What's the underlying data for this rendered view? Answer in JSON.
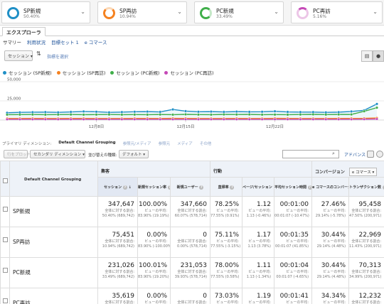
{
  "segments": [
    {
      "name": "SP新規",
      "pct": "50.40%",
      "color": "#1f8fc6"
    },
    {
      "name": "SP再訪",
      "pct": "10.94%",
      "color": "#f58220"
    },
    {
      "name": "PC新規",
      "pct": "33.49%",
      "color": "#3fae49"
    },
    {
      "name": "PC再訪",
      "pct": "5.16%",
      "color": "#c549b7"
    }
  ],
  "tabs": {
    "explorer": "エクスプローラ"
  },
  "subnav": {
    "summary": "サマリー",
    "site_usage": "利用状況",
    "goal_set": "目標セット 1",
    "ecommerce": "e コマース"
  },
  "chart_controls": {
    "metric": "セッション",
    "add_metric": "指標を選択"
  },
  "chart_data": {
    "type": "line",
    "x": [
      "12/01",
      "12/02",
      "12/03",
      "12/04",
      "12/05",
      "12/06",
      "12/07",
      "12/08",
      "12/09",
      "12/10",
      "12/11",
      "12/12",
      "12/13",
      "12/14",
      "12/15",
      "12/16",
      "12/17",
      "12/18",
      "12/19",
      "12/20",
      "12/21",
      "12/22",
      "12/23",
      "12/24",
      "12/25",
      "12/26",
      "12/27",
      "12/28",
      "12/29",
      "12/30"
    ],
    "x_tick_labels": [
      "12月8日",
      "12月15日",
      "12月22日"
    ],
    "y_tick_labels": [
      "50,000",
      "25,000"
    ],
    "ylim": [
      0,
      50000
    ],
    "grid": true,
    "series": [
      {
        "name": "セッション (SP新規)",
        "color": "#1f8fc6",
        "values": [
          9500,
          10000,
          10200,
          10400,
          10000,
          10600,
          11200,
          10800,
          10000,
          10400,
          10800,
          11000,
          10600,
          13800,
          11600,
          10800,
          11000,
          10600,
          11000,
          10700,
          10800,
          11400,
          10600,
          10400,
          10400,
          10000,
          10300,
          11200,
          12700,
          21000
        ]
      },
      {
        "name": "セッション (SP再訪)",
        "color": "#f58220",
        "values": [
          2000,
          2000,
          2100,
          2000,
          2000,
          2100,
          2100,
          2000,
          2000,
          2000,
          2100,
          2100,
          2000,
          2200,
          2100,
          2000,
          2000,
          2000,
          2100,
          2000,
          2000,
          2200,
          2100,
          2000,
          2000,
          2000,
          2100,
          2100,
          2200,
          2700
        ]
      },
      {
        "name": "セッション (PC新規)",
        "color": "#3fae49",
        "values": [
          7000,
          7100,
          7200,
          7000,
          7100,
          7200,
          7000,
          7100,
          7200,
          7000,
          7100,
          7000,
          7200,
          7000,
          7400,
          7100,
          7000,
          7300,
          7200,
          7300,
          7000,
          7100,
          7000,
          7200,
          7400,
          7100,
          7300,
          7300,
          11400,
          16100
        ]
      },
      {
        "name": "セッション (PC再訪)",
        "color": "#c549b7",
        "values": [
          1000,
          1000,
          1000,
          1000,
          1000,
          1000,
          1000,
          1000,
          1000,
          1000,
          1000,
          1000,
          1000,
          1000,
          1000,
          1000,
          1000,
          1000,
          1000,
          1000,
          1000,
          1000,
          1000,
          1000,
          1000,
          1000,
          1000,
          1000,
          1100,
          1400
        ]
      }
    ]
  },
  "dimensions": {
    "label": "プライマリ ディメンション:",
    "active": "Default Channel Grouping",
    "others": [
      "参照元/メディア",
      "参照元",
      "メディア",
      "その他"
    ]
  },
  "toolbar": {
    "secondary_dim": "セカンダリ ディメンション",
    "sort_label": "並び替えの種類:",
    "sort_value": "デフォルト",
    "advanced": "アドバンス",
    "plot_rows": "行をプロット"
  },
  "table": {
    "dim_header": "Default Channel Grouping",
    "groups": {
      "acquisition": "集客",
      "behavior": "行動",
      "conversion": "コンバージョン",
      "conversion_select": "e コマース"
    },
    "columns": [
      "セッション",
      "新規セッション率",
      "新規ユーザー",
      "直帰率",
      "ページ/セッション",
      "平均セッション時間",
      "e コマースのコンバージョン率",
      "トランザクション数"
    ],
    "rows": [
      {
        "label": "SP新規",
        "cells": [
          {
            "v": "347,647",
            "s1": "全体に対する割合:",
            "s2": "50.40% (689,742)"
          },
          {
            "v": "100.00%",
            "s1": "ビューの平均:",
            "s2": "83.90% (19.19%)"
          },
          {
            "v": "347,660",
            "s1": "全体に対する割合:",
            "s2": "60.07% (578,714)"
          },
          {
            "v": "78.25%",
            "s1": "ビューの平均:",
            "s2": "77.55% (0.91%)"
          },
          {
            "v": "1.12",
            "s1": "ビューの平均:",
            "s2": "1.13 (-0.46%)"
          },
          {
            "v": "00:01:00",
            "s1": "ビューの平均:",
            "s2": "00:01:07 (-10.47%)"
          },
          {
            "v": "27.46%",
            "s1": "ビューの平均:",
            "s2": "29.14% (-5.78%)"
          },
          {
            "v": "95,458",
            "s1": "全体に対する割合:",
            "s2": "47.50% (200,971)"
          }
        ]
      },
      {
        "label": "SP再訪",
        "cells": [
          {
            "v": "75,451",
            "s1": "全体に対する割合:",
            "s2": "10.94% (689,742)"
          },
          {
            "v": "0.00%",
            "s1": "ビューの平均:",
            "s2": "83.90% (-100.00%)"
          },
          {
            "v": "0",
            "s1": "全体に対する割合:",
            "s2": "0.00% (578,714)"
          },
          {
            "v": "75.11%",
            "s1": "ビューの平均:",
            "s2": "77.55% (-3.15%)"
          },
          {
            "v": "1.17",
            "s1": "ビューの平均:",
            "s2": "1.13 (3.78%)"
          },
          {
            "v": "00:01:35",
            "s1": "ビューの平均:",
            "s2": "00:01:07 (41.85%)"
          },
          {
            "v": "30.44%",
            "s1": "ビューの平均:",
            "s2": "29.14% (4.48%)"
          },
          {
            "v": "22,969",
            "s1": "全体に対する割合:",
            "s2": "11.43% (200,971)"
          }
        ]
      },
      {
        "label": "PC新規",
        "cells": [
          {
            "v": "231,026",
            "s1": "全体に対する割合:",
            "s2": "33.49% (689,742)"
          },
          {
            "v": "100.01%",
            "s1": "ビューの平均:",
            "s2": "83.90% (19.20%)"
          },
          {
            "v": "231,053",
            "s1": "全体に対する割合:",
            "s2": "39.93% (578,714)"
          },
          {
            "v": "78.00%",
            "s1": "ビューの平均:",
            "s2": "77.55% (0.58%)"
          },
          {
            "v": "1.11",
            "s1": "ビューの平均:",
            "s2": "1.13 (-1.34%)"
          },
          {
            "v": "00:01:04",
            "s1": "ビューの平均:",
            "s2": "00:01:07 (-4.65%)"
          },
          {
            "v": "30.44%",
            "s1": "ビューの平均:",
            "s2": "29.14% (4.48%)"
          },
          {
            "v": "70,313",
            "s1": "全体に対する割合:",
            "s2": "34.99% (200,971)"
          }
        ]
      },
      {
        "label": "PC再訪",
        "cells": [
          {
            "v": "35,619",
            "s1": "全体に対する割合:",
            "s2": "5.16% (689,742)"
          },
          {
            "v": "0.00%",
            "s1": "ビューの平均:",
            "s2": "83.90% (-100.00%)"
          },
          {
            "v": "0",
            "s1": "全体に対する割合:",
            "s2": "0.00% (578,714)"
          },
          {
            "v": "73.03%",
            "s1": "ビューの平均:",
            "s2": "77.55% (-5.83%)"
          },
          {
            "v": "1.19",
            "s1": "ビューの平均:",
            "s2": "1.13 (5.23%)"
          },
          {
            "v": "00:01:41",
            "s1": "ビューの平均:",
            "s2": "00:01:07 (49.96%)"
          },
          {
            "v": "34.34%",
            "s1": "ビューの平均:",
            "s2": "29.14% (17.85%)"
          },
          {
            "v": "12,232",
            "s1": "全体に対する割合:",
            "s2": "6.09% (200,971)"
          }
        ]
      }
    ]
  }
}
